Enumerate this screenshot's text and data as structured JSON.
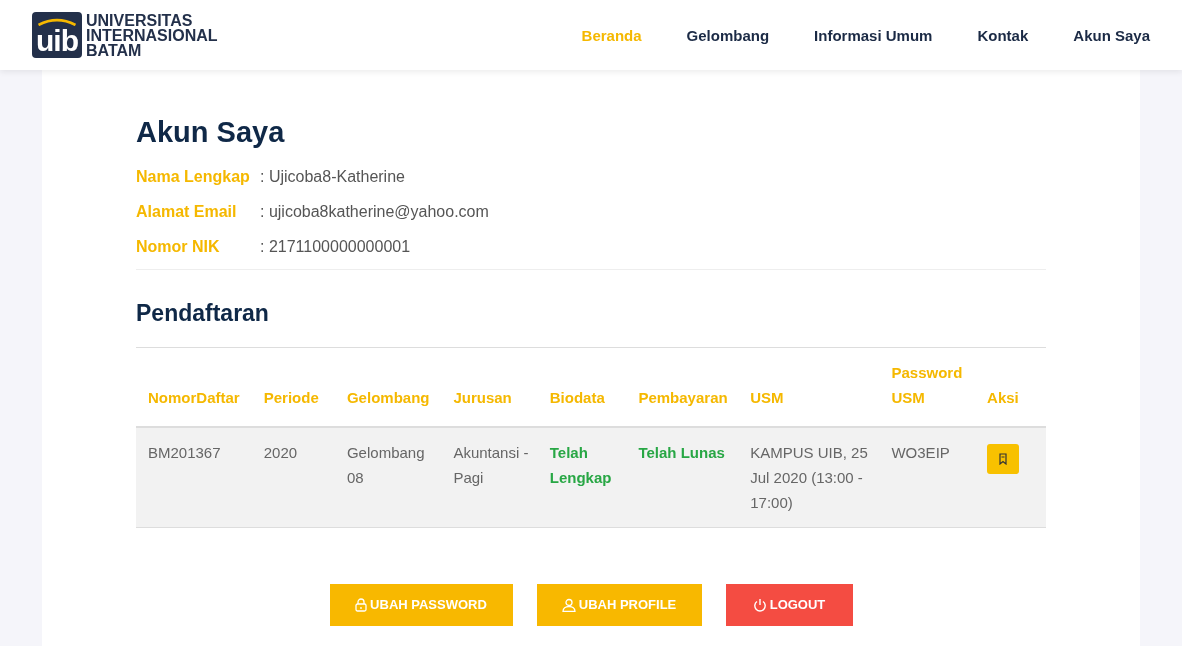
{
  "header": {
    "logo_mark": "uib",
    "logo_lines": [
      "UNIVERSITAS",
      "INTERNASIONAL",
      "BATAM"
    ],
    "nav": [
      {
        "label": "Beranda",
        "selected": true
      },
      {
        "label": "Gelombang",
        "selected": false
      },
      {
        "label": "Informasi Umum",
        "selected": false
      },
      {
        "label": "Kontak",
        "selected": false
      },
      {
        "label": "Akun Saya",
        "selected": false
      }
    ]
  },
  "account": {
    "title": "Akun Saya",
    "fields": [
      {
        "label": "Nama Lengkap",
        "value": ": Ujicoba8-Katherine"
      },
      {
        "label": "Alamat Email",
        "value": ": ujicoba8katherine@yahoo.com"
      },
      {
        "label": "Nomor NIK",
        "value": ": 2171100000000001"
      }
    ]
  },
  "registration": {
    "title": "Pendaftaran",
    "columns": [
      "NomorDaftar",
      "Periode",
      "Gelombang",
      "Jurusan",
      "Biodata",
      "Pembayaran",
      "USM",
      "Password USM",
      "Aksi"
    ],
    "rows": [
      {
        "cells": [
          {
            "kind": "text",
            "text": "BM201367"
          },
          {
            "kind": "text",
            "text": "2020"
          },
          {
            "kind": "text",
            "text": "Gelombang 08"
          },
          {
            "kind": "text",
            "text": "Akuntansi - Pagi"
          },
          {
            "kind": "status",
            "text": "Telah Lengkap"
          },
          {
            "kind": "status",
            "text": "Telah Lunas"
          },
          {
            "kind": "text",
            "text": "KAMPUS UIB, 25 Jul 2020 (13:00 - 17:00)"
          },
          {
            "kind": "text",
            "text": "WO3EIP"
          },
          {
            "kind": "action"
          }
        ]
      }
    ]
  },
  "buttons": [
    {
      "kind": "password",
      "label": "UBAH PASSWORD"
    },
    {
      "kind": "profile",
      "label": "UBAH PROFILE"
    },
    {
      "kind": "logout",
      "label": "LOGOUT"
    }
  ]
}
